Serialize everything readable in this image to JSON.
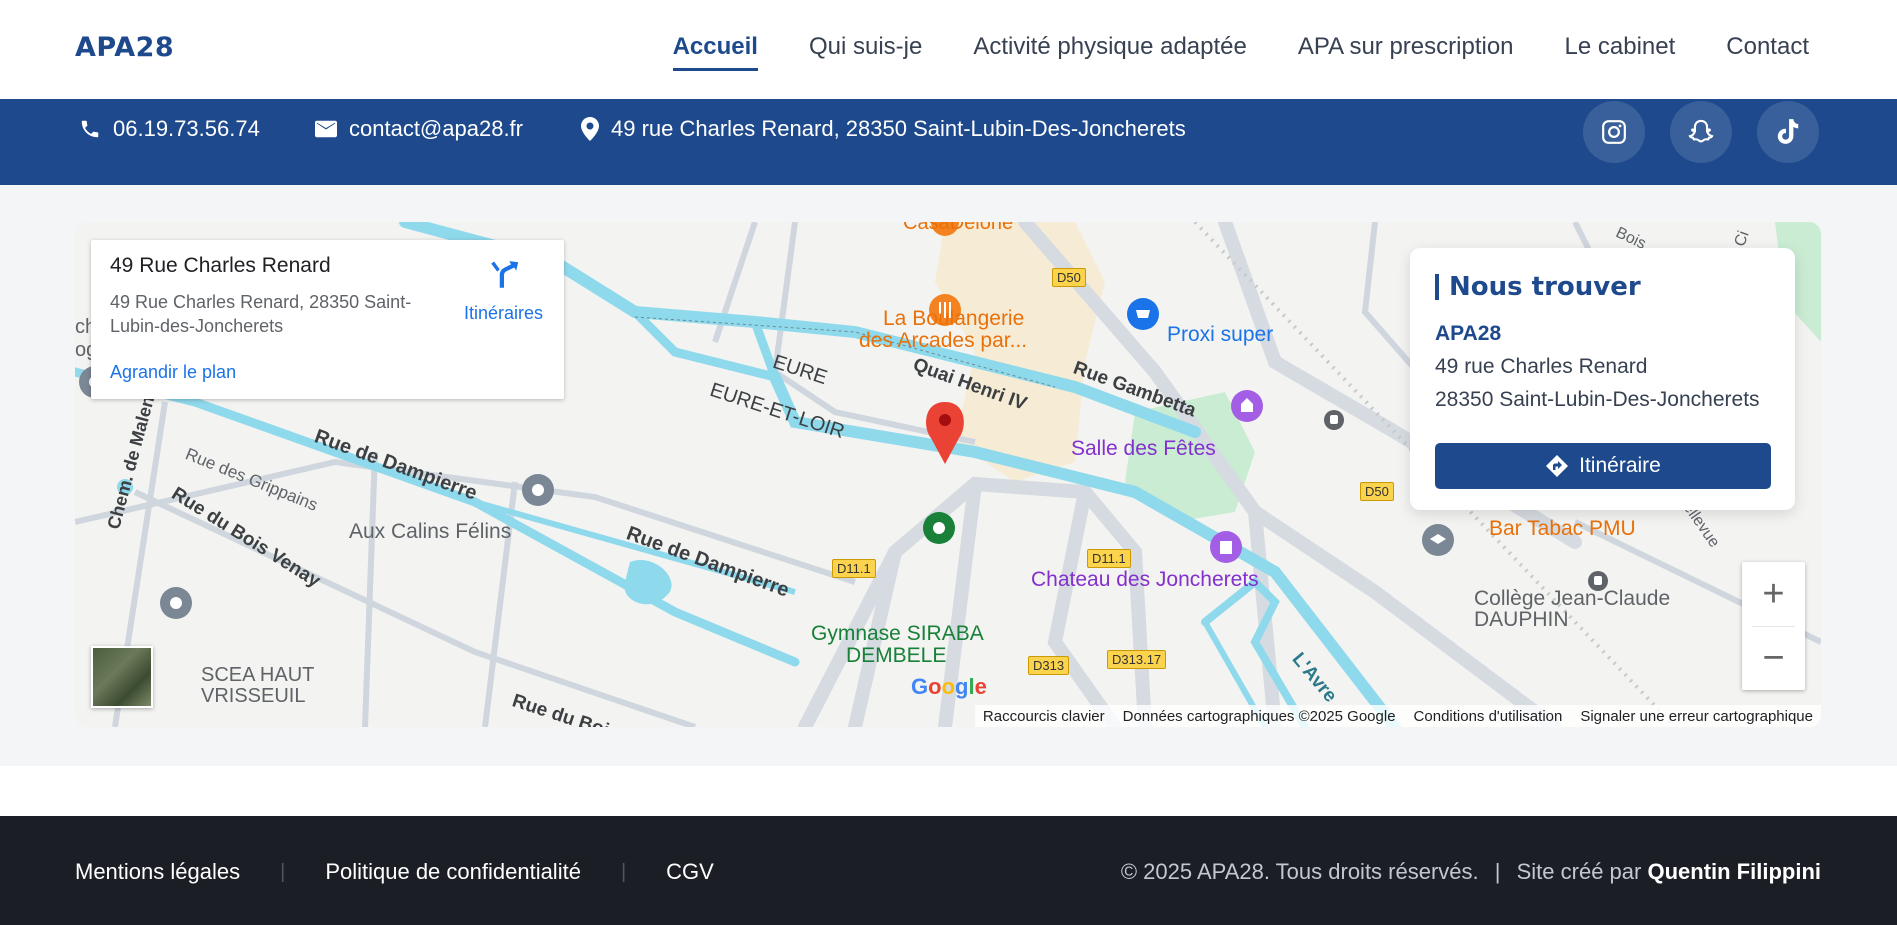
{
  "nav": {
    "logo": "APA28",
    "items": [
      {
        "label": "Accueil",
        "active": true
      },
      {
        "label": "Qui suis-je"
      },
      {
        "label": "Activité physique adaptée"
      },
      {
        "label": "APA sur prescription"
      },
      {
        "label": "Le cabinet"
      },
      {
        "label": "Contact"
      }
    ]
  },
  "contact_bar": {
    "phone": "06.19.73.56.74",
    "email": "contact@apa28.fr",
    "address": "49 rue Charles Renard, 28350 Saint-Lubin-Des-Joncherets",
    "socials": [
      {
        "icon": "instagram-icon"
      },
      {
        "icon": "snapchat-icon"
      },
      {
        "icon": "tiktok-icon"
      }
    ],
    "colors": {
      "background": "#1e4a8d",
      "text": "#ffffff"
    }
  },
  "map": {
    "place_card": {
      "title": "49 Rue Charles Renard",
      "address": "49 Rue Charles Renard, 28350 Saint-Lubin-des-Joncherets",
      "directions_label": "Itinéraires",
      "enlarge_label": "Agrandir le plan"
    },
    "labels": {
      "casadelone": "CasaDelone",
      "boulangerie_1": "La Boulangerie",
      "boulangerie_2": "des Arcades par...",
      "proxi": "Proxi super",
      "eure": "EURE",
      "eure_et_loir": "EURE-ET-LOIR",
      "quai": "Quai Henri IV",
      "gambetta": "Rue Gambetta",
      "salle": "Salle des Fêtes",
      "dampierre_1": "Rue de Dampierre",
      "dampierre_2": "Rue de Dampierre",
      "grippains": "Rue des Grippains",
      "calins": "Aux Calins Félins",
      "bois_venay": "Rue du Bois Venay",
      "malenge": "Chem. de Malenge",
      "scea_1": "SCEA HAUT",
      "scea_2": "VRISSEUIL",
      "bois_bottom": "Rue du Bois",
      "gymnase_1": "Gymnase SIRABA",
      "gymnase_2": "DEMBELE",
      "chateau": "Chateau des Joncherets",
      "bar": "Bar Tabac PMU",
      "college_1": "Collège Jean-Claude",
      "college_2": "DAUPHIN",
      "avre": "L'Avre",
      "bellevue": "Bellevue",
      "bois_top": "Bois",
      "ch": "ch",
      "og": "og",
      "ci": "Ci",
      "d50_1": "D50",
      "d50_2": "D50",
      "d111_1": "D11.1",
      "d111_2": "D11.1",
      "d313": "D313",
      "d31317": "D313.17"
    },
    "attribution": {
      "shortcuts": "Raccourcis clavier",
      "data": "Données cartographiques ©2025 Google",
      "terms": "Conditions d'utilisation",
      "report": "Signaler une erreur cartographique"
    },
    "google_logo": "Google",
    "zoom_in": "+",
    "zoom_out": "−"
  },
  "find_card": {
    "title": "Nous trouver",
    "name": "APA28",
    "line1": "49 rue Charles Renard",
    "line2": "28350 Saint-Lubin-Des-Joncherets",
    "button": "Itinéraire"
  },
  "footer": {
    "links": [
      "Mentions légales",
      "Politique de confidentialité",
      "CGV"
    ],
    "separator": "|",
    "copyright": "© 2025 APA28. Tous droits réservés.",
    "divider": "|",
    "credit_prefix": "Site créé par",
    "credit_name": "Quentin Filippini"
  }
}
